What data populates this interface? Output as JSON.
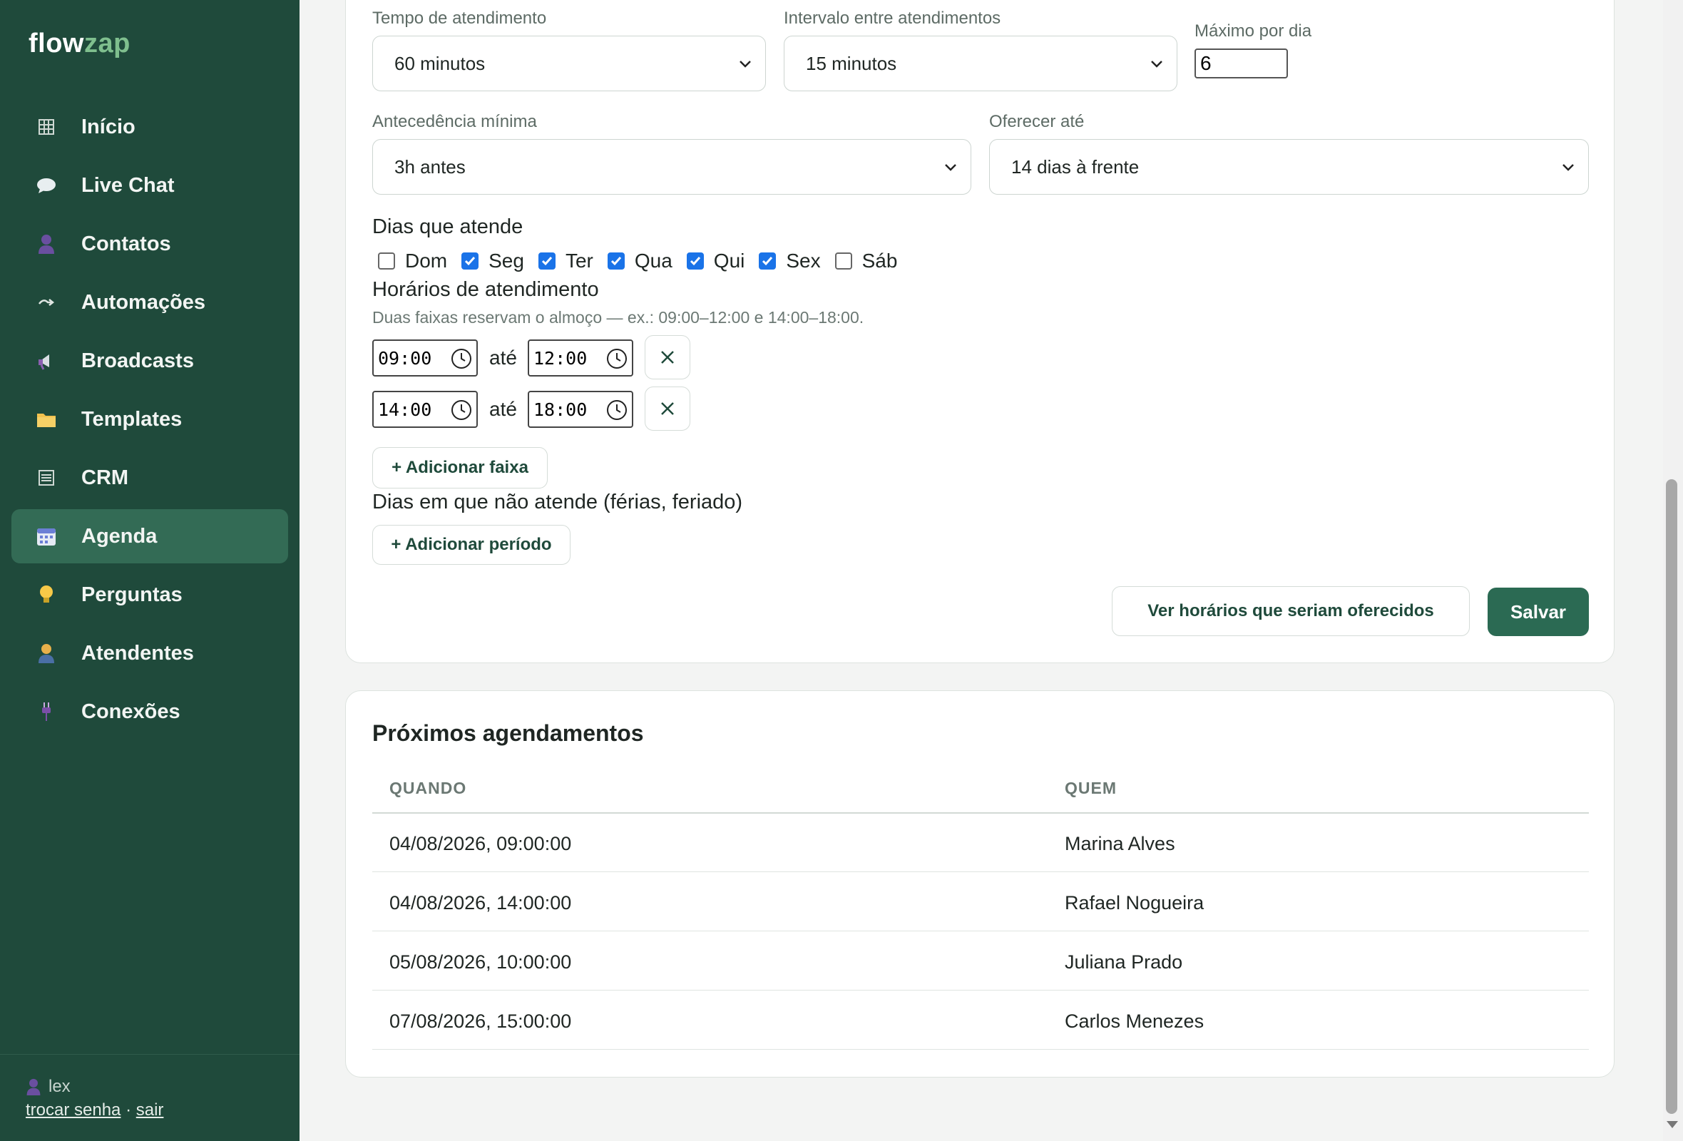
{
  "app": {
    "logo_part1": "flow",
    "logo_part2": "zap"
  },
  "sidebar": {
    "items": [
      {
        "label": "Início",
        "icon": "grid-icon",
        "active": false
      },
      {
        "label": "Live Chat",
        "icon": "chat-bubble-icon",
        "active": false
      },
      {
        "label": "Contatos",
        "icon": "person-icon",
        "active": false
      },
      {
        "label": "Automações",
        "icon": "arrow-icon",
        "active": false
      },
      {
        "label": "Broadcasts",
        "icon": "megaphone-icon",
        "active": false
      },
      {
        "label": "Templates",
        "icon": "folder-icon",
        "active": false
      },
      {
        "label": "CRM",
        "icon": "list-icon",
        "active": false
      },
      {
        "label": "Agenda",
        "icon": "calendar-icon",
        "active": true
      },
      {
        "label": "Perguntas",
        "icon": "lightbulb-icon",
        "active": false
      },
      {
        "label": "Atendentes",
        "icon": "agent-icon",
        "active": false
      },
      {
        "label": "Conexões",
        "icon": "plug-icon",
        "active": false
      }
    ],
    "user": "lex",
    "change_password": "trocar senha",
    "separator": "·",
    "logout": "sair"
  },
  "settings": {
    "duration": {
      "label": "Tempo de atendimento",
      "value": "60 minutos"
    },
    "interval": {
      "label": "Intervalo entre atendimentos",
      "value": "15 minutos"
    },
    "max_per_day": {
      "label": "Máximo por dia",
      "value": "6"
    },
    "min_notice": {
      "label": "Antecedência mínima",
      "value": "3h antes"
    },
    "offer_until": {
      "label": "Oferecer até",
      "value": "14 dias à frente"
    },
    "days": {
      "title": "Dias que atende",
      "items": [
        {
          "label": "Dom",
          "checked": false
        },
        {
          "label": "Seg",
          "checked": true
        },
        {
          "label": "Ter",
          "checked": true
        },
        {
          "label": "Qua",
          "checked": true
        },
        {
          "label": "Qui",
          "checked": true
        },
        {
          "label": "Sex",
          "checked": true
        },
        {
          "label": "Sáb",
          "checked": false
        }
      ]
    },
    "hours": {
      "title": "Horários de atendimento",
      "hint": "Duas faixas reservam o almoço — ex.: 09:00–12:00 e 14:00–18:00.",
      "separator": "até",
      "ranges": [
        {
          "start": "09:00",
          "end": "12:00"
        },
        {
          "start": "14:00",
          "end": "18:00"
        }
      ],
      "add_label": "+ Adicionar faixa"
    },
    "off_days": {
      "title": "Dias em que não atende (férias, feriado)",
      "add_label": "+ Adicionar período"
    },
    "preview_label": "Ver horários que seriam oferecidos",
    "save_label": "Salvar"
  },
  "appointments": {
    "title": "Próximos agendamentos",
    "columns": [
      "QUANDO",
      "QUEM"
    ],
    "rows": [
      {
        "when": "04/08/2026, 09:00:00",
        "who": "Marina Alves"
      },
      {
        "when": "04/08/2026, 14:00:00",
        "who": "Rafael Nogueira"
      },
      {
        "when": "05/08/2026, 10:00:00",
        "who": "Juliana Prado"
      },
      {
        "when": "07/08/2026, 15:00:00",
        "who": "Carlos Menezes"
      }
    ]
  },
  "colors": {
    "sidebar": "#1f4a3b",
    "active": "#336b55",
    "primary": "#2b6a53",
    "checkbox": "#1a73e8"
  }
}
